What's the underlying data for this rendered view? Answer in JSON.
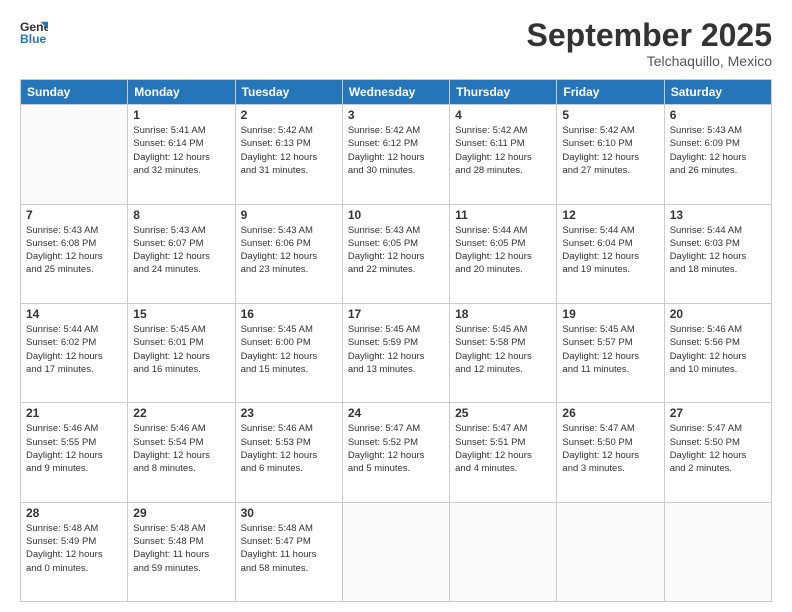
{
  "header": {
    "logo": {
      "general": "General",
      "blue": "Blue"
    },
    "title": "September 2025",
    "location": "Telchaquillo, Mexico"
  },
  "calendar": {
    "days_of_week": [
      "Sunday",
      "Monday",
      "Tuesday",
      "Wednesday",
      "Thursday",
      "Friday",
      "Saturday"
    ],
    "weeks": [
      [
        {
          "day": "",
          "info": ""
        },
        {
          "day": "1",
          "info": "Sunrise: 5:41 AM\nSunset: 6:14 PM\nDaylight: 12 hours\nand 32 minutes."
        },
        {
          "day": "2",
          "info": "Sunrise: 5:42 AM\nSunset: 6:13 PM\nDaylight: 12 hours\nand 31 minutes."
        },
        {
          "day": "3",
          "info": "Sunrise: 5:42 AM\nSunset: 6:12 PM\nDaylight: 12 hours\nand 30 minutes."
        },
        {
          "day": "4",
          "info": "Sunrise: 5:42 AM\nSunset: 6:11 PM\nDaylight: 12 hours\nand 28 minutes."
        },
        {
          "day": "5",
          "info": "Sunrise: 5:42 AM\nSunset: 6:10 PM\nDaylight: 12 hours\nand 27 minutes."
        },
        {
          "day": "6",
          "info": "Sunrise: 5:43 AM\nSunset: 6:09 PM\nDaylight: 12 hours\nand 26 minutes."
        }
      ],
      [
        {
          "day": "7",
          "info": "Sunrise: 5:43 AM\nSunset: 6:08 PM\nDaylight: 12 hours\nand 25 minutes."
        },
        {
          "day": "8",
          "info": "Sunrise: 5:43 AM\nSunset: 6:07 PM\nDaylight: 12 hours\nand 24 minutes."
        },
        {
          "day": "9",
          "info": "Sunrise: 5:43 AM\nSunset: 6:06 PM\nDaylight: 12 hours\nand 23 minutes."
        },
        {
          "day": "10",
          "info": "Sunrise: 5:43 AM\nSunset: 6:05 PM\nDaylight: 12 hours\nand 22 minutes."
        },
        {
          "day": "11",
          "info": "Sunrise: 5:44 AM\nSunset: 6:05 PM\nDaylight: 12 hours\nand 20 minutes."
        },
        {
          "day": "12",
          "info": "Sunrise: 5:44 AM\nSunset: 6:04 PM\nDaylight: 12 hours\nand 19 minutes."
        },
        {
          "day": "13",
          "info": "Sunrise: 5:44 AM\nSunset: 6:03 PM\nDaylight: 12 hours\nand 18 minutes."
        }
      ],
      [
        {
          "day": "14",
          "info": "Sunrise: 5:44 AM\nSunset: 6:02 PM\nDaylight: 12 hours\nand 17 minutes."
        },
        {
          "day": "15",
          "info": "Sunrise: 5:45 AM\nSunset: 6:01 PM\nDaylight: 12 hours\nand 16 minutes."
        },
        {
          "day": "16",
          "info": "Sunrise: 5:45 AM\nSunset: 6:00 PM\nDaylight: 12 hours\nand 15 minutes."
        },
        {
          "day": "17",
          "info": "Sunrise: 5:45 AM\nSunset: 5:59 PM\nDaylight: 12 hours\nand 13 minutes."
        },
        {
          "day": "18",
          "info": "Sunrise: 5:45 AM\nSunset: 5:58 PM\nDaylight: 12 hours\nand 12 minutes."
        },
        {
          "day": "19",
          "info": "Sunrise: 5:45 AM\nSunset: 5:57 PM\nDaylight: 12 hours\nand 11 minutes."
        },
        {
          "day": "20",
          "info": "Sunrise: 5:46 AM\nSunset: 5:56 PM\nDaylight: 12 hours\nand 10 minutes."
        }
      ],
      [
        {
          "day": "21",
          "info": "Sunrise: 5:46 AM\nSunset: 5:55 PM\nDaylight: 12 hours\nand 9 minutes."
        },
        {
          "day": "22",
          "info": "Sunrise: 5:46 AM\nSunset: 5:54 PM\nDaylight: 12 hours\nand 8 minutes."
        },
        {
          "day": "23",
          "info": "Sunrise: 5:46 AM\nSunset: 5:53 PM\nDaylight: 12 hours\nand 6 minutes."
        },
        {
          "day": "24",
          "info": "Sunrise: 5:47 AM\nSunset: 5:52 PM\nDaylight: 12 hours\nand 5 minutes."
        },
        {
          "day": "25",
          "info": "Sunrise: 5:47 AM\nSunset: 5:51 PM\nDaylight: 12 hours\nand 4 minutes."
        },
        {
          "day": "26",
          "info": "Sunrise: 5:47 AM\nSunset: 5:50 PM\nDaylight: 12 hours\nand 3 minutes."
        },
        {
          "day": "27",
          "info": "Sunrise: 5:47 AM\nSunset: 5:50 PM\nDaylight: 12 hours\nand 2 minutes."
        }
      ],
      [
        {
          "day": "28",
          "info": "Sunrise: 5:48 AM\nSunset: 5:49 PM\nDaylight: 12 hours\nand 0 minutes."
        },
        {
          "day": "29",
          "info": "Sunrise: 5:48 AM\nSunset: 5:48 PM\nDaylight: 11 hours\nand 59 minutes."
        },
        {
          "day": "30",
          "info": "Sunrise: 5:48 AM\nSunset: 5:47 PM\nDaylight: 11 hours\nand 58 minutes."
        },
        {
          "day": "",
          "info": ""
        },
        {
          "day": "",
          "info": ""
        },
        {
          "day": "",
          "info": ""
        },
        {
          "day": "",
          "info": ""
        }
      ]
    ]
  }
}
